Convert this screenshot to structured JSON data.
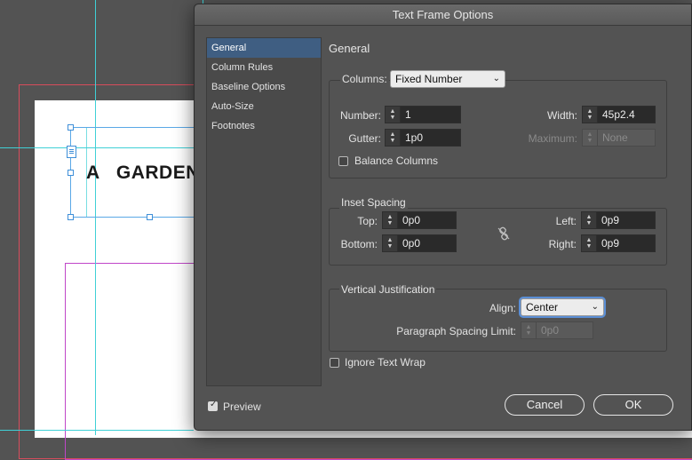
{
  "canvas": {
    "frame_text": "A   GARDEN"
  },
  "dialog": {
    "title": "Text Frame Options",
    "sidebar": [
      {
        "label": "General",
        "active": true
      },
      {
        "label": "Column Rules",
        "active": false
      },
      {
        "label": "Baseline Options",
        "active": false
      },
      {
        "label": "Auto-Size",
        "active": false
      },
      {
        "label": "Footnotes",
        "active": false
      }
    ],
    "section_title": "General",
    "columns": {
      "label": "Columns:",
      "type_value": "Fixed Number",
      "number_label": "Number:",
      "number_value": "1",
      "gutter_label": "Gutter:",
      "gutter_value": "1p0",
      "width_label": "Width:",
      "width_value": "45p2.4",
      "maximum_label": "Maximum:",
      "maximum_value": "None",
      "balance_label": "Balance Columns",
      "balance_checked": false
    },
    "inset": {
      "label": "Inset Spacing",
      "top_label": "Top:",
      "top_value": "0p0",
      "bottom_label": "Bottom:",
      "bottom_value": "0p0",
      "left_label": "Left:",
      "left_value": "0p9",
      "right_label": "Right:",
      "right_value": "0p9"
    },
    "vertical": {
      "label": "Vertical Justification",
      "align_label": "Align:",
      "align_value": "Center",
      "spacing_label": "Paragraph Spacing Limit:",
      "spacing_value": "0p0"
    },
    "ignore_wrap_label": "Ignore Text Wrap",
    "ignore_wrap_checked": false,
    "preview_label": "Preview",
    "preview_checked": true,
    "cancel_label": "Cancel",
    "ok_label": "OK"
  },
  "colors": {
    "accent": "#3f5e82",
    "guide_cyan": "#3fd0d6",
    "margin_magenta": "#c046c8",
    "bleed_red": "#d84c5c"
  }
}
